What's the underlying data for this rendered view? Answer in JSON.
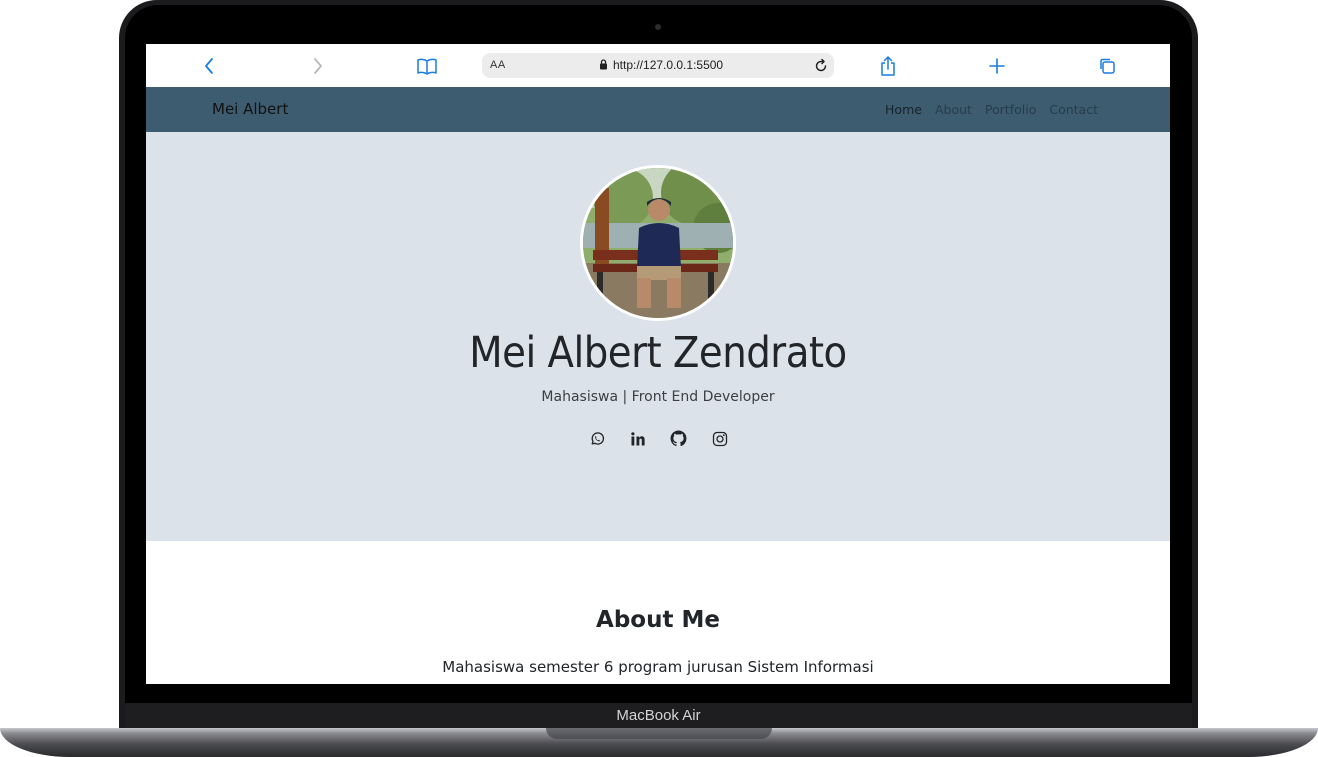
{
  "device": {
    "label": "MacBook Air"
  },
  "browser": {
    "url": "http://127.0.0.1:5500",
    "reader_label": "AA"
  },
  "navbar": {
    "brand": "Mei Albert",
    "links": [
      {
        "label": "Home"
      },
      {
        "label": "About"
      },
      {
        "label": "Portfolio"
      },
      {
        "label": "Contact"
      }
    ]
  },
  "hero": {
    "name": "Mei Albert Zendrato",
    "subtitle": "Mahasiswa | Front End Developer",
    "socials": [
      {
        "icon": "whatsapp-icon"
      },
      {
        "icon": "linkedin-icon"
      },
      {
        "icon": "github-icon"
      },
      {
        "icon": "instagram-icon"
      }
    ]
  },
  "about": {
    "title": "About Me",
    "text": "Mahasiswa semester 6 program jurusan Sistem Informasi"
  },
  "colors": {
    "navbar": "#3d5c70",
    "hero_bg": "#dbe2ea",
    "safari_blue": "#1a7de0"
  }
}
